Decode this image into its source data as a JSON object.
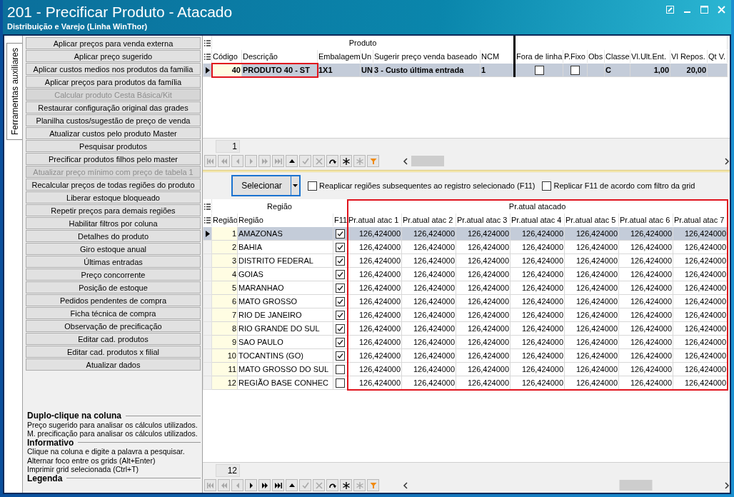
{
  "window": {
    "title": "201 - Precificar Produto - Atacado",
    "subtitle": "Distribuição e Varejo (Linha WinThor)"
  },
  "side_tab": {
    "label": "Ferramentas auxiliares",
    "selected": true
  },
  "tools": [
    {
      "label": "Aplicar preços para venda externa",
      "disabled": false
    },
    {
      "label": "Aplicar preço sugerido",
      "disabled": false
    },
    {
      "label": "Aplicar custos medios nos produtos da familia",
      "disabled": false
    },
    {
      "label": "Aplicar preços para produtos da família",
      "disabled": false
    },
    {
      "label": "Calcular produto Cesta Básica/Kit",
      "disabled": true
    },
    {
      "label": "Restaurar configuração original das grades",
      "disabled": false
    },
    {
      "label": "Planilha custos/sugestão de preço de venda",
      "disabled": false
    },
    {
      "label": "Atualizar custos pelo produto Master",
      "disabled": false
    },
    {
      "label": "Pesquisar produtos",
      "disabled": false
    },
    {
      "label": "Precificar produtos filhos pelo master",
      "disabled": false
    },
    {
      "label": "Atualizar preço mínimo com preço de tabela 1",
      "disabled": true
    },
    {
      "label": "Recalcular preços de todas regiões do produto",
      "disabled": false
    },
    {
      "label": "Liberar estoque bloqueado",
      "disabled": false
    },
    {
      "label": "Repetir preços para demais regiões",
      "disabled": false
    },
    {
      "label": "Habilitar filtros por coluna",
      "disabled": false
    },
    {
      "label": "Detalhes do produto",
      "disabled": false
    },
    {
      "label": "Giro estoque anual",
      "disabled": false
    },
    {
      "label": "Últimas entradas",
      "disabled": false
    },
    {
      "label": "Preço concorrente",
      "disabled": false
    },
    {
      "label": "Posição de estoque",
      "disabled": false
    },
    {
      "label": "Pedidos pendentes de compra",
      "disabled": false
    },
    {
      "label": "Ficha técnica de compra",
      "disabled": false
    },
    {
      "label": "Observação de precificação",
      "disabled": false
    },
    {
      "label": "Editar cad. produtos",
      "disabled": false
    },
    {
      "label": "Editar cad. produtos x filial",
      "disabled": false
    },
    {
      "label": "Atualizar dados",
      "disabled": false
    }
  ],
  "legend": [
    {
      "heading": "Duplo-clique na coluna",
      "lines": [
        "Preço sugerido para analisar os cálculos utilizados.",
        "M. precificação para analisar os cálculos utilizados."
      ]
    },
    {
      "heading": "Informativo",
      "lines": [
        "Clique na coluna e digite a palavra a pesquisar.",
        "Alternar foco entre os grids (Alt+Enter)",
        "Imprimir grid selecionada (Ctrl+T)"
      ]
    },
    {
      "heading": "Legenda"
    }
  ],
  "product_grid": {
    "groups": [
      {
        "label": "Produto",
        "columns": [
          {
            "label": "Código",
            "kind": "key",
            "framed": true
          },
          {
            "label": "Descrição",
            "kind": "text",
            "framed": true
          },
          {
            "label": "Embalagem",
            "kind": "text"
          },
          {
            "label": "Un",
            "kind": "text"
          },
          {
            "label": "Sugerir preço venda baseado",
            "kind": "text"
          },
          {
            "label": "NCM",
            "kind": "text"
          }
        ]
      },
      {
        "separated": true,
        "columns": [
          {
            "label": "Fora de linha",
            "kind": "check"
          },
          {
            "label": "P.Fixo",
            "kind": "check"
          },
          {
            "label": "Obs",
            "kind": "text"
          },
          {
            "label": "Classe",
            "kind": "text"
          },
          {
            "label": "Vl.Ult.Ent.",
            "kind": "number"
          },
          {
            "label": "Vl Repos.",
            "kind": "number"
          },
          {
            "label": "Qt V.",
            "kind": "number"
          }
        ]
      }
    ],
    "rows": [
      {
        "selected": true,
        "bold": true,
        "cells": [
          {
            "text": "40"
          },
          {
            "text": "PRODUTO 40 - ST"
          },
          {
            "text": "1X1"
          },
          {
            "text": "UN"
          },
          {
            "text": "3 - Custo última entrada"
          },
          {
            "text": "1"
          },
          {
            "checked": false
          },
          {
            "checked": false
          },
          {},
          {
            "text": "C"
          },
          {
            "text": "1,00"
          },
          {
            "text": "20,00"
          },
          {}
        ]
      }
    ],
    "record_count": "1",
    "navigator": [
      {
        "kind": "first",
        "disabled": true
      },
      {
        "kind": "prior-page",
        "disabled": true
      },
      {
        "kind": "prior",
        "disabled": true
      },
      {
        "kind": "next",
        "disabled": true
      },
      {
        "kind": "next-page",
        "disabled": true
      },
      {
        "kind": "last",
        "disabled": true
      },
      {
        "kind": "insert",
        "disabled": false
      },
      {
        "kind": "post",
        "disabled": true
      },
      {
        "kind": "cancel",
        "disabled": true
      },
      {
        "kind": "refresh",
        "disabled": false
      },
      {
        "kind": "asterisk",
        "disabled": false
      },
      {
        "kind": "asterisk",
        "disabled": true
      },
      {
        "kind": "filter",
        "disabled": false
      }
    ]
  },
  "actions": {
    "select_button": "Selecionar",
    "checkboxes": [
      {
        "label": "Reaplicar regiões subsequentes ao registro selecionado (F11)",
        "checked": false
      },
      {
        "label": "Replicar F11 de acordo com filtro da grid",
        "checked": false
      }
    ]
  },
  "region_grid": {
    "groups": [
      {
        "label": "Região",
        "columns": [
          {
            "label": "Região",
            "kind": "key"
          },
          {
            "label": "Região",
            "kind": "text"
          },
          {
            "label": "F11",
            "kind": "check"
          }
        ]
      },
      {
        "label": "Pr.atual atacado",
        "framed": true,
        "columns": [
          {
            "label": "Pr.atual atac 1",
            "kind": "number"
          },
          {
            "label": "Pr.atual atac 2",
            "kind": "number"
          },
          {
            "label": "Pr.atual atac 3",
            "kind": "number"
          },
          {
            "label": "Pr.atual atac 4",
            "kind": "number"
          },
          {
            "label": "Pr.atual atac 5",
            "kind": "number"
          },
          {
            "label": "Pr.atual atac 6",
            "kind": "number"
          },
          {
            "label": "Pr.atual atac 7",
            "kind": "number"
          }
        ]
      }
    ],
    "rows": [
      {
        "selected": true,
        "cells": [
          {
            "text": "1"
          },
          {
            "text": "AMAZONAS"
          },
          {
            "checked": true
          },
          {
            "text": "126,424000"
          },
          {
            "text": "126,424000"
          },
          {
            "text": "126,424000"
          },
          {
            "text": "126,424000"
          },
          {
            "text": "126,424000"
          },
          {
            "text": "126,424000"
          },
          {
            "text": "126,424000"
          }
        ]
      },
      {
        "selected": false,
        "cells": [
          {
            "text": "2"
          },
          {
            "text": "BAHIA"
          },
          {
            "checked": true
          },
          {
            "text": "126,424000"
          },
          {
            "text": "126,424000"
          },
          {
            "text": "126,424000"
          },
          {
            "text": "126,424000"
          },
          {
            "text": "126,424000"
          },
          {
            "text": "126,424000"
          },
          {
            "text": "126,424000"
          }
        ]
      },
      {
        "selected": false,
        "cells": [
          {
            "text": "3"
          },
          {
            "text": "DISTRITO FEDERAL"
          },
          {
            "checked": true
          },
          {
            "text": "126,424000"
          },
          {
            "text": "126,424000"
          },
          {
            "text": "126,424000"
          },
          {
            "text": "126,424000"
          },
          {
            "text": "126,424000"
          },
          {
            "text": "126,424000"
          },
          {
            "text": "126,424000"
          }
        ]
      },
      {
        "selected": false,
        "cells": [
          {
            "text": "4"
          },
          {
            "text": "GOIAS"
          },
          {
            "checked": true
          },
          {
            "text": "126,424000"
          },
          {
            "text": "126,424000"
          },
          {
            "text": "126,424000"
          },
          {
            "text": "126,424000"
          },
          {
            "text": "126,424000"
          },
          {
            "text": "126,424000"
          },
          {
            "text": "126,424000"
          }
        ]
      },
      {
        "selected": false,
        "cells": [
          {
            "text": "5"
          },
          {
            "text": "MARANHAO"
          },
          {
            "checked": true
          },
          {
            "text": "126,424000"
          },
          {
            "text": "126,424000"
          },
          {
            "text": "126,424000"
          },
          {
            "text": "126,424000"
          },
          {
            "text": "126,424000"
          },
          {
            "text": "126,424000"
          },
          {
            "text": "126,424000"
          }
        ]
      },
      {
        "selected": false,
        "cells": [
          {
            "text": "6"
          },
          {
            "text": "MATO GROSSO"
          },
          {
            "checked": true
          },
          {
            "text": "126,424000"
          },
          {
            "text": "126,424000"
          },
          {
            "text": "126,424000"
          },
          {
            "text": "126,424000"
          },
          {
            "text": "126,424000"
          },
          {
            "text": "126,424000"
          },
          {
            "text": "126,424000"
          }
        ]
      },
      {
        "selected": false,
        "cells": [
          {
            "text": "7"
          },
          {
            "text": "RIO DE JANEIRO"
          },
          {
            "checked": true
          },
          {
            "text": "126,424000"
          },
          {
            "text": "126,424000"
          },
          {
            "text": "126,424000"
          },
          {
            "text": "126,424000"
          },
          {
            "text": "126,424000"
          },
          {
            "text": "126,424000"
          },
          {
            "text": "126,424000"
          }
        ]
      },
      {
        "selected": false,
        "cells": [
          {
            "text": "8"
          },
          {
            "text": "RIO GRANDE DO SUL"
          },
          {
            "checked": true
          },
          {
            "text": "126,424000"
          },
          {
            "text": "126,424000"
          },
          {
            "text": "126,424000"
          },
          {
            "text": "126,424000"
          },
          {
            "text": "126,424000"
          },
          {
            "text": "126,424000"
          },
          {
            "text": "126,424000"
          }
        ]
      },
      {
        "selected": false,
        "cells": [
          {
            "text": "9"
          },
          {
            "text": "SAO PAULO"
          },
          {
            "checked": true
          },
          {
            "text": "126,424000"
          },
          {
            "text": "126,424000"
          },
          {
            "text": "126,424000"
          },
          {
            "text": "126,424000"
          },
          {
            "text": "126,424000"
          },
          {
            "text": "126,424000"
          },
          {
            "text": "126,424000"
          }
        ]
      },
      {
        "selected": false,
        "cells": [
          {
            "text": "10"
          },
          {
            "text": "TOCANTINS (GO)"
          },
          {
            "checked": true
          },
          {
            "text": "126,424000"
          },
          {
            "text": "126,424000"
          },
          {
            "text": "126,424000"
          },
          {
            "text": "126,424000"
          },
          {
            "text": "126,424000"
          },
          {
            "text": "126,424000"
          },
          {
            "text": "126,424000"
          }
        ]
      },
      {
        "selected": false,
        "cells": [
          {
            "text": "11"
          },
          {
            "text": "MATO GROSSO DO SUL"
          },
          {
            "checked": false
          },
          {
            "text": "126,424000"
          },
          {
            "text": "126,424000"
          },
          {
            "text": "126,424000"
          },
          {
            "text": "126,424000"
          },
          {
            "text": "126,424000"
          },
          {
            "text": "126,424000"
          },
          {
            "text": "126,424000"
          }
        ]
      },
      {
        "selected": false,
        "cells": [
          {
            "text": "12"
          },
          {
            "text": "REGIÃO BASE CONHEC"
          },
          {
            "checked": false
          },
          {
            "text": "126,424000"
          },
          {
            "text": "126,424000"
          },
          {
            "text": "126,424000"
          },
          {
            "text": "126,424000"
          },
          {
            "text": "126,424000"
          },
          {
            "text": "126,424000"
          },
          {
            "text": "126,424000"
          }
        ]
      }
    ],
    "record_count": "12",
    "navigator": [
      {
        "kind": "first",
        "disabled": true
      },
      {
        "kind": "prior-page",
        "disabled": true
      },
      {
        "kind": "prior",
        "disabled": true
      },
      {
        "kind": "next",
        "disabled": false
      },
      {
        "kind": "next-page",
        "disabled": false
      },
      {
        "kind": "last",
        "disabled": false
      },
      {
        "kind": "insert",
        "disabled": false
      },
      {
        "kind": "post",
        "disabled": true
      },
      {
        "kind": "cancel",
        "disabled": true
      },
      {
        "kind": "refresh",
        "disabled": false
      },
      {
        "kind": "asterisk",
        "disabled": false
      },
      {
        "kind": "asterisk",
        "disabled": true
      },
      {
        "kind": "filter",
        "disabled": false
      }
    ]
  }
}
